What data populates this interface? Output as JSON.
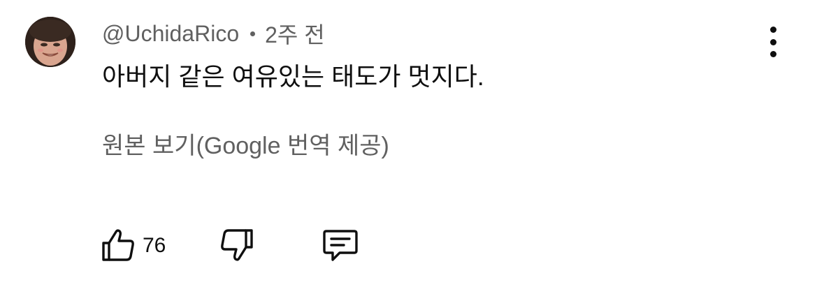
{
  "comment": {
    "author": "@UchidaRico",
    "timestamp": "2주 전",
    "text": "아버지 같은 여유있는 태도가 멋지다.",
    "translate_label": "원본 보기(Google 번역 제공)",
    "like_count": "76",
    "avatar_icon": "user-avatar",
    "more_icon": "more-vert-icon",
    "like_icon": "thumb-up-icon",
    "dislike_icon": "thumb-down-icon",
    "reply_icon": "comment-reply-icon"
  },
  "colors": {
    "primary_text": "#0f0f0f",
    "secondary_text": "#606060",
    "background": "#ffffff"
  }
}
